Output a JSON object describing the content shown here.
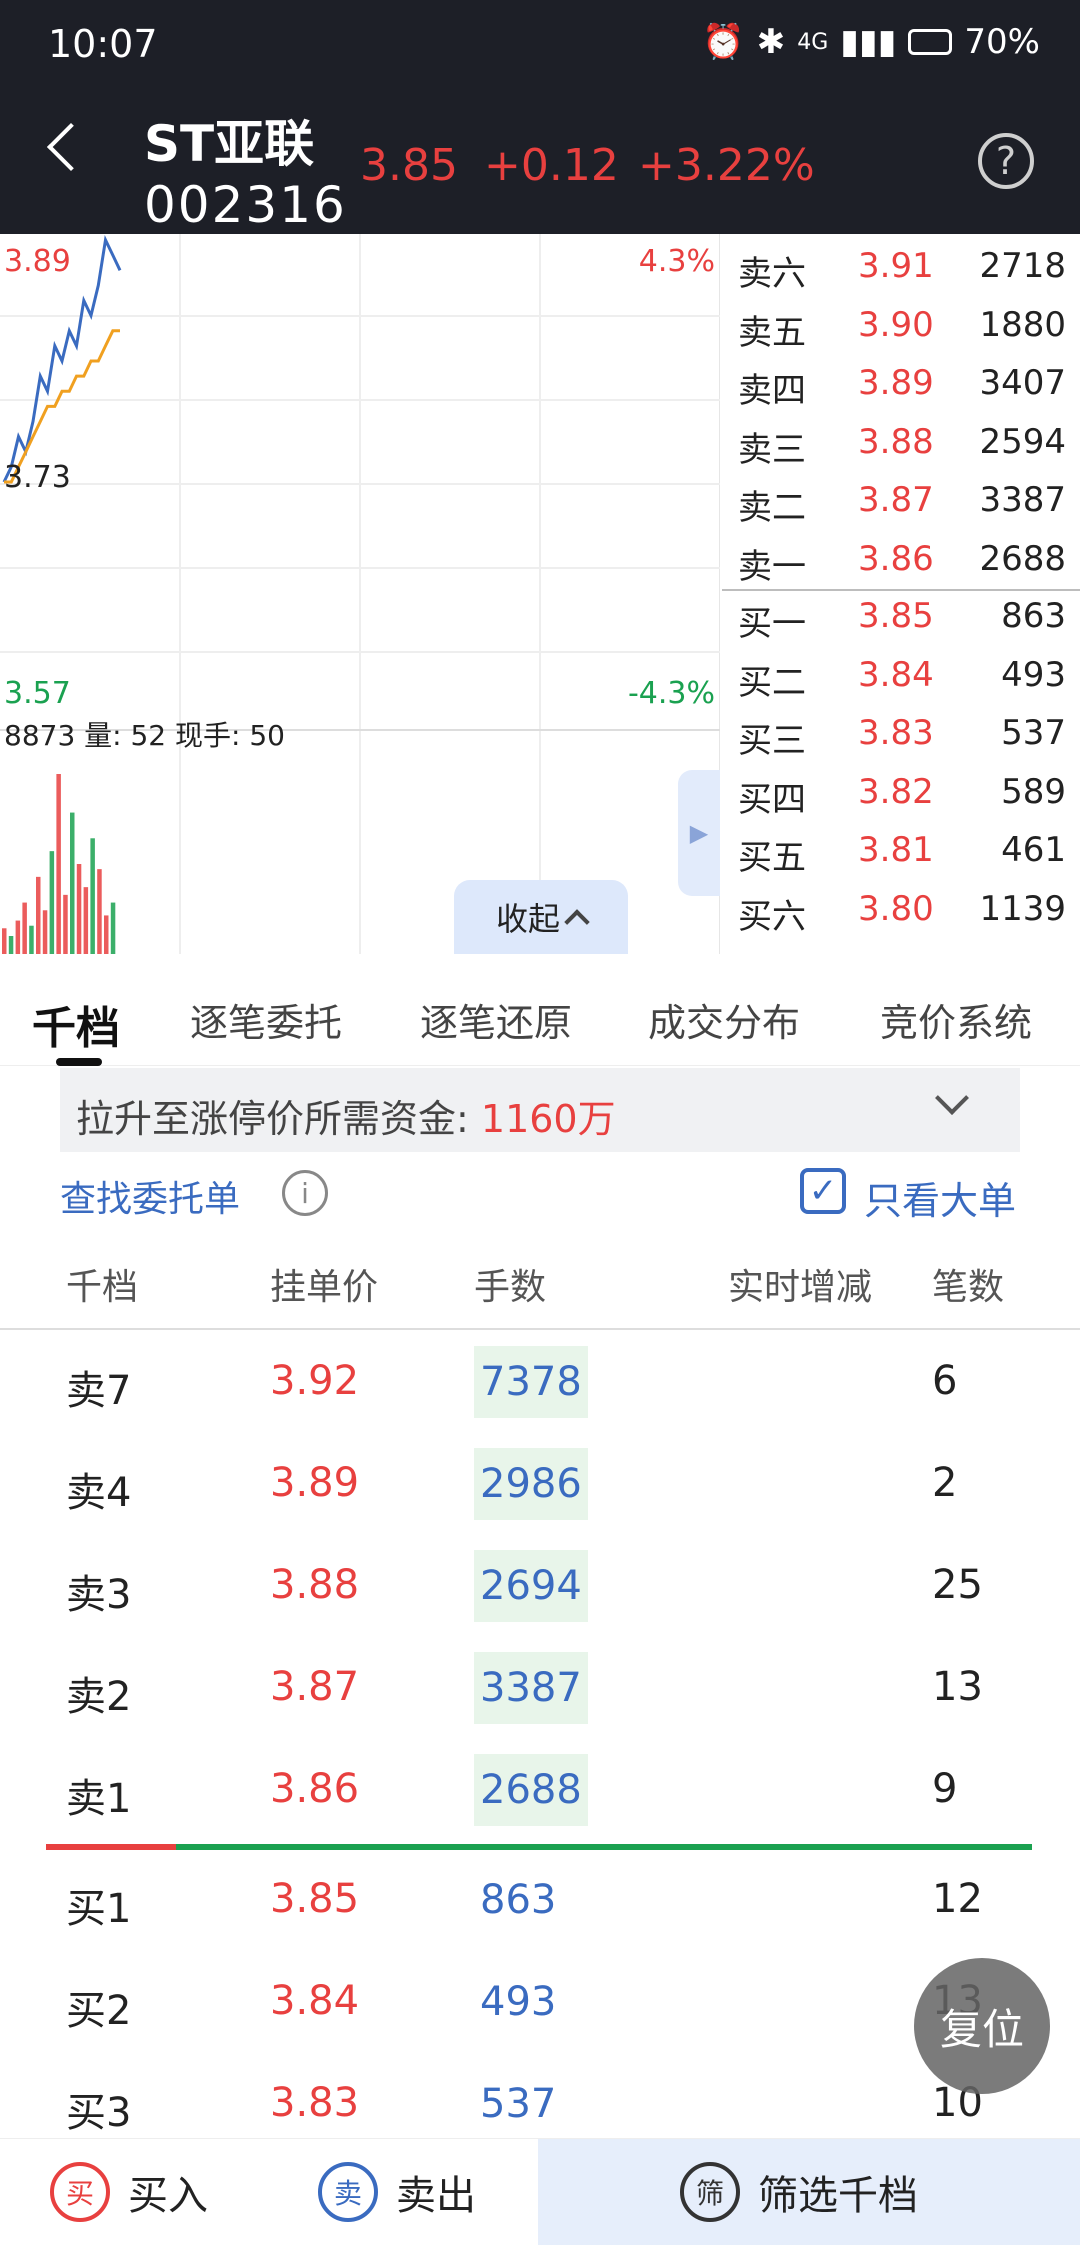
{
  "status": {
    "time": "10:07",
    "battery": "70%",
    "signal": "4G"
  },
  "header": {
    "name": "ST亚联",
    "code": "002316",
    "price": "3.85",
    "change": "+0.12",
    "change_pct": "+3.22%"
  },
  "chart": {
    "labels": {
      "high": "3.89",
      "mid": "3.73",
      "low": "3.57",
      "pct_up": "4.3%",
      "pct_down": "-4.3%"
    },
    "volume_text": "8873 量: 52 现手: 50",
    "collapse_label": "收起"
  },
  "chart_data": {
    "type": "line",
    "series": [
      {
        "values": [
          3.73,
          3.74,
          3.76,
          3.75,
          3.77,
          3.8,
          3.79,
          3.82,
          3.81,
          3.83,
          3.82,
          3.85,
          3.84,
          3.86,
          3.89,
          3.88,
          3.87
        ]
      },
      {
        "values": [
          3.73,
          3.73,
          3.74,
          3.75,
          3.76,
          3.77,
          3.78,
          3.78,
          3.79,
          3.79,
          3.8,
          3.8,
          3.81,
          3.81,
          3.82,
          3.83,
          3.83
        ]
      }
    ],
    "volume": [
      20,
      14,
      26,
      40,
      22,
      60,
      34,
      80,
      140,
      46,
      110,
      70,
      52,
      90,
      66,
      30,
      40
    ],
    "ylim": [
      3.57,
      3.89
    ]
  },
  "order_book": {
    "asks": [
      {
        "label": "卖六",
        "price": "3.91",
        "qty": "2718"
      },
      {
        "label": "卖五",
        "price": "3.90",
        "qty": "1880"
      },
      {
        "label": "卖四",
        "price": "3.89",
        "qty": "3407"
      },
      {
        "label": "卖三",
        "price": "3.88",
        "qty": "2594"
      },
      {
        "label": "卖二",
        "price": "3.87",
        "qty": "3387"
      },
      {
        "label": "卖一",
        "price": "3.86",
        "qty": "2688"
      }
    ],
    "bids": [
      {
        "label": "买一",
        "price": "3.85",
        "qty": "863"
      },
      {
        "label": "买二",
        "price": "3.84",
        "qty": "493"
      },
      {
        "label": "买三",
        "price": "3.83",
        "qty": "537"
      },
      {
        "label": "买四",
        "price": "3.82",
        "qty": "589"
      },
      {
        "label": "买五",
        "price": "3.81",
        "qty": "461"
      },
      {
        "label": "买六",
        "price": "3.80",
        "qty": "1139"
      }
    ]
  },
  "tabs": [
    "千档",
    "逐笔委托",
    "逐笔还原",
    "成交分布",
    "竞价系统"
  ],
  "funds": {
    "label": "拉升至涨停价所需资金: ",
    "value": "1160万"
  },
  "find_label": "查找委托单",
  "big_only_label": "只看大单",
  "table": {
    "headers": [
      "千档",
      "挂单价",
      "手数",
      "实时增减",
      "笔数"
    ],
    "rows": [
      {
        "level": "卖7",
        "price": "3.92",
        "qty": "7378",
        "count": "6"
      },
      {
        "level": "卖4",
        "price": "3.89",
        "qty": "2986",
        "count": "2"
      },
      {
        "level": "卖3",
        "price": "3.88",
        "qty": "2694",
        "count": "25"
      },
      {
        "level": "卖2",
        "price": "3.87",
        "qty": "3387",
        "count": "13"
      },
      {
        "level": "卖1",
        "price": "3.86",
        "qty": "2688",
        "count": "9"
      },
      {
        "level": "买1",
        "price": "3.85",
        "qty": "863",
        "count": "12"
      },
      {
        "level": "买2",
        "price": "3.84",
        "qty": "493",
        "count": "13"
      },
      {
        "level": "买3",
        "price": "3.83",
        "qty": "537",
        "count": "10"
      }
    ]
  },
  "reset_label": "复位",
  "bottom": {
    "buy": "买入",
    "buy_icon": "买",
    "sell": "卖出",
    "sell_icon": "卖",
    "filter": "筛选千档",
    "filter_icon": "筛"
  }
}
